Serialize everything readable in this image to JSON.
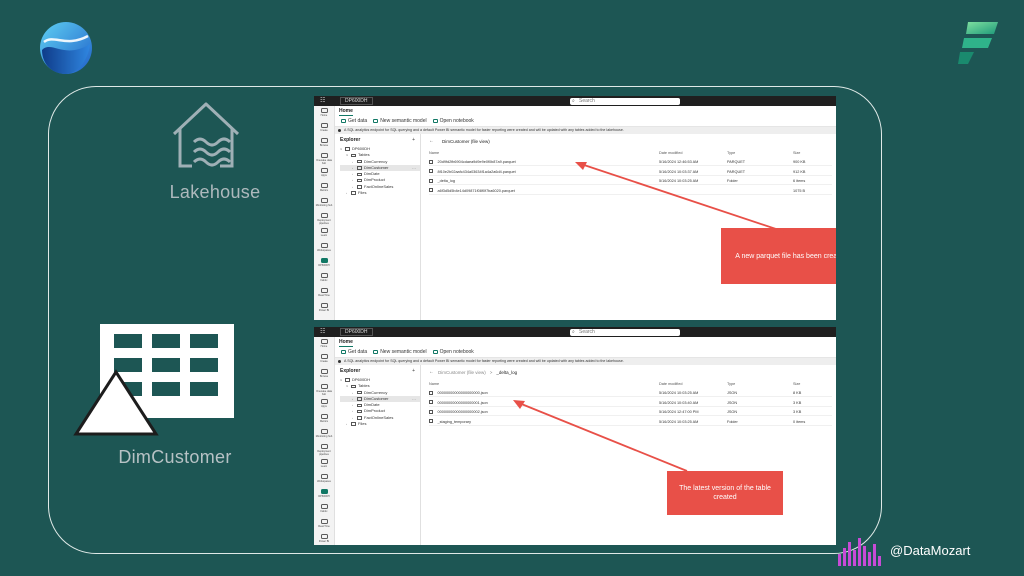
{
  "labels": {
    "lakehouse": "Lakehouse",
    "dimcustomer": "DimCustomer",
    "handle": "@DataMozart"
  },
  "colors": {
    "background": "#1d5654",
    "accent": "#117865",
    "callout": "#e85048"
  },
  "rail": [
    "Home",
    "Create",
    "Browse",
    "OneLake data hub",
    "Apps",
    "Metrics",
    "Monitoring hub",
    "Deployment pipelines",
    "Learn",
    "Workspaces",
    "DP600DH",
    "Fabric",
    "Real-Time",
    "Power BI"
  ],
  "screens": [
    {
      "workspace": "DP600DH",
      "search": "Search",
      "home_tab": "Home",
      "toolbar": [
        "Get data",
        "New semantic model",
        "Open notebook"
      ],
      "info": "A SQL analytics endpoint for SQL querying and a default Power BI semantic model for faster reporting were created and will be updated with any tables added to the lakehouse.",
      "explorer": {
        "title": "Explorer",
        "add": "+",
        "lakehouse": "DP600DH",
        "tables_label": "Tables",
        "files_label": "Files",
        "tables": [
          "DimCurrency",
          "DimCustomer",
          "DimDate",
          "DimProduct",
          "FactOnlineSales"
        ],
        "selected": 1
      },
      "breadcrumb": {
        "prev": "",
        "current": "DimCustomer (file view)"
      },
      "columns": {
        "name": "Name",
        "date": "Date modified",
        "type": "Type",
        "size": "Size"
      },
      "rows": [
        {
          "name": "20d9fd2fb6904cdaea9d9e9e0f0b87a9.parquet",
          "date": "5/16/2024 12:46:53 AM",
          "type": "PARQUET",
          "size": "900 KB"
        },
        {
          "name": "8f10e2b02aafc434a03634f1a4a2a6d4.parquet",
          "date": "5/16/2024 10:03:37 AM",
          "type": "PARQUET",
          "size": "912 KB"
        },
        {
          "name": "_delta_log",
          "date": "5/16/2024 10:03:25 AM",
          "type": "Folder",
          "size": "6 items"
        },
        {
          "name": "a6f3d5d5b4e14d09871f08f0f7ba6020.parquet",
          "date": "",
          "type": "",
          "size": "1075 B"
        }
      ],
      "callout": "A new parquet file has been created..."
    },
    {
      "workspace": "DP600DH",
      "search": "Search",
      "home_tab": "Home",
      "toolbar": [
        "Get data",
        "New semantic model",
        "Open notebook"
      ],
      "info": "A SQL analytics endpoint for SQL querying and a default Power BI semantic model for faster reporting were created and will be updated with any tables added to the lakehouse.",
      "explorer": {
        "title": "Explorer",
        "add": "+",
        "lakehouse": "DP600DH",
        "tables_label": "Tables",
        "files_label": "Files",
        "tables": [
          "DimCurrency",
          "DimCustomer",
          "DimDate",
          "DimProduct",
          "FactOnlineSales"
        ],
        "selected": 1
      },
      "breadcrumb": {
        "prev": "DimCustomer (file view)",
        "current": "_delta_log"
      },
      "columns": {
        "name": "Name",
        "date": "Date modified",
        "type": "Type",
        "size": "Size"
      },
      "rows": [
        {
          "name": "00000000000000000000.json",
          "date": "5/16/2024 10:03:25 AM",
          "type": "JSON",
          "size": "8 KB"
        },
        {
          "name": "00000000000000000001.json",
          "date": "5/16/2024 10:03:40 AM",
          "type": "JSON",
          "size": "3 KB"
        },
        {
          "name": "00000000000000000002.json",
          "date": "5/16/2024 12:47:00 PM",
          "type": "JSON",
          "size": "3 KB"
        },
        {
          "name": "_staging_temporary",
          "date": "5/16/2024 10:03:25 AM",
          "type": "Folder",
          "size": "0 items"
        }
      ],
      "callout": "The latest version of the table created"
    }
  ]
}
